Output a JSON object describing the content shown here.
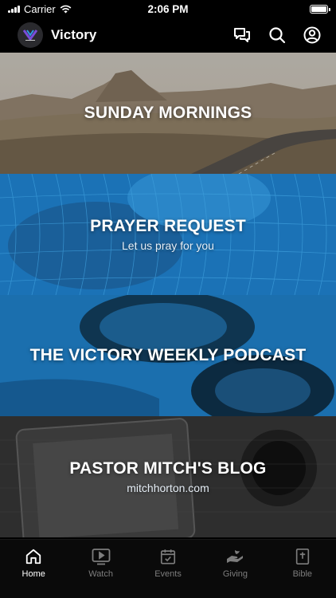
{
  "status_bar": {
    "carrier": "Carrier",
    "time": "2:06 PM"
  },
  "header": {
    "title": "Victory"
  },
  "cards": [
    {
      "title": "SUNDAY MORNINGS",
      "subtitle": ""
    },
    {
      "title": "PRAYER REQUEST",
      "subtitle": "Let us pray for you"
    },
    {
      "title": "THE VICTORY WEEKLY PODCAST",
      "subtitle": ""
    },
    {
      "title": "PASTOR MITCH'S BLOG",
      "subtitle": "mitchhorton.com"
    }
  ],
  "tabs": [
    {
      "label": "Home",
      "icon": "home-icon",
      "active": true
    },
    {
      "label": "Watch",
      "icon": "watch-icon",
      "active": false
    },
    {
      "label": "Events",
      "icon": "calendar-icon",
      "active": false
    },
    {
      "label": "Giving",
      "icon": "giving-icon",
      "active": false
    },
    {
      "label": "Bible",
      "icon": "bible-icon",
      "active": false
    }
  ],
  "colors": {
    "background": "#000000",
    "accent_blue": "#1e73b8",
    "tab_inactive": "#7d7d7d",
    "tab_active": "#ffffff"
  }
}
